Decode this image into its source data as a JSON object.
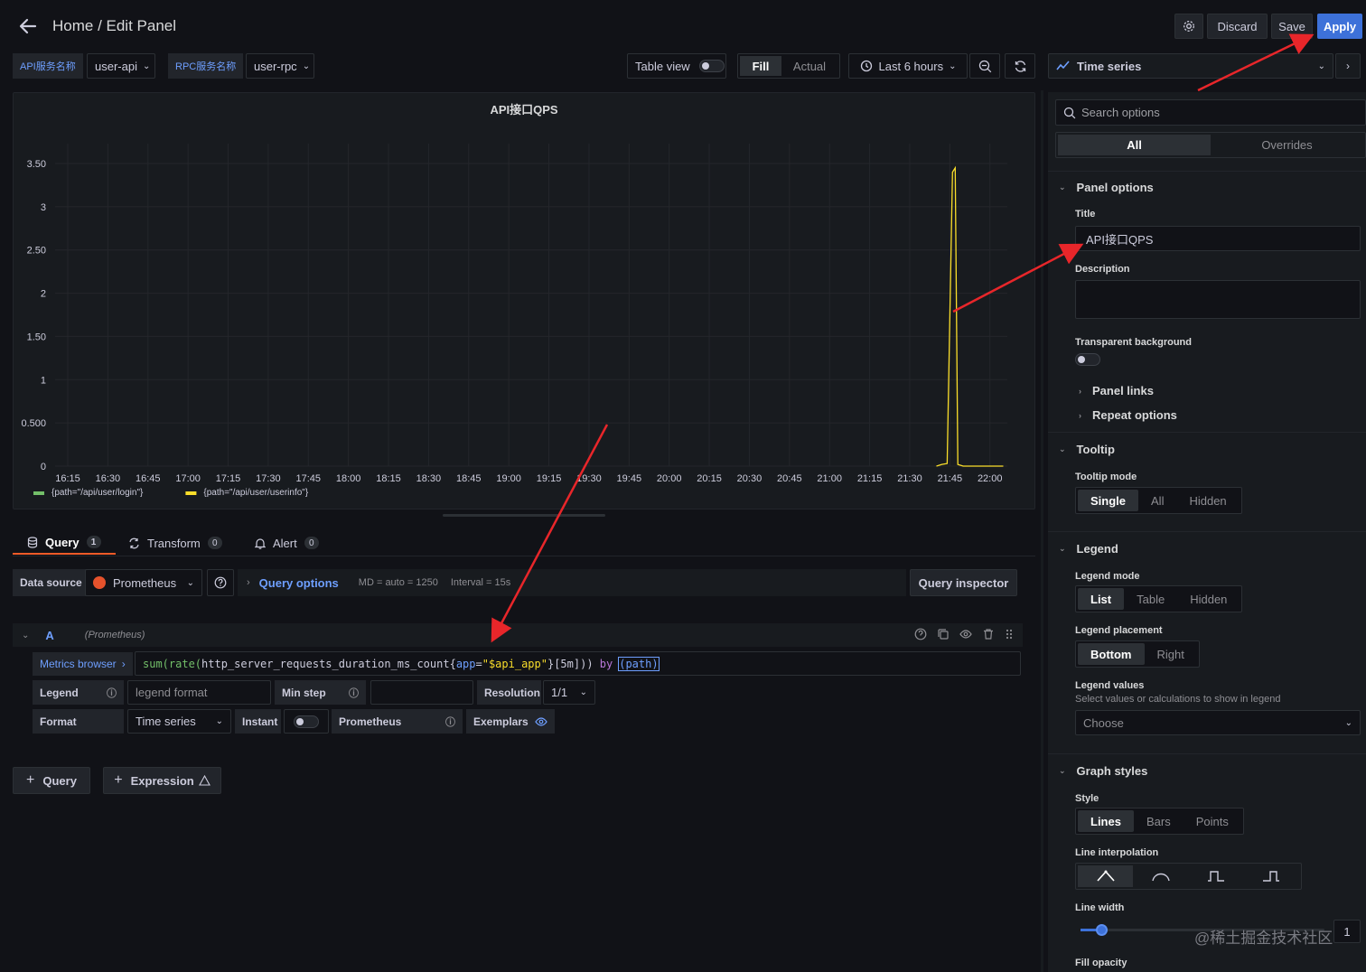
{
  "header": {
    "breadcrumb": "Home / Edit Panel",
    "discard_label": "Discard",
    "save_label": "Save",
    "apply_label": "Apply"
  },
  "variables": [
    {
      "label": "API服务名称",
      "value": "user-api"
    },
    {
      "label": "RPC服务名称",
      "value": "user-rpc"
    }
  ],
  "toolbar": {
    "table_view_label": "Table view",
    "fill_label": "Fill",
    "actual_label": "Actual",
    "time_range": "Last 6 hours",
    "visualization": "Time series"
  },
  "panel": {
    "title": "API接口QPS"
  },
  "chart_data": {
    "type": "line",
    "title": "API接口QPS",
    "x": [
      "16:15",
      "16:30",
      "16:45",
      "17:00",
      "17:15",
      "17:30",
      "17:45",
      "18:00",
      "18:15",
      "18:30",
      "18:45",
      "19:00",
      "19:15",
      "19:30",
      "19:45",
      "20:00",
      "20:15",
      "20:30",
      "20:45",
      "21:00",
      "21:15",
      "21:30",
      "21:45",
      "22:00"
    ],
    "yticks": [
      "0",
      "0.500",
      "1",
      "1.50",
      "2",
      "2.50",
      "3",
      "3.50"
    ],
    "ylim": [
      0,
      3.5
    ],
    "grid": true,
    "legend_placement": "bottom",
    "series": [
      {
        "name": "{path=\"/api/user/login\"}",
        "color": "#73bf69",
        "points": []
      },
      {
        "name": "{path=\"/api/user/userinfo\"}",
        "color": "#fade2a",
        "points": [
          [
            "21:40",
            0
          ],
          [
            "21:42",
            0.02
          ],
          [
            "21:44",
            0.03
          ],
          [
            "21:46",
            3.4
          ],
          [
            "21:47",
            3.45
          ],
          [
            "21:48",
            0.02
          ],
          [
            "21:50",
            0
          ],
          [
            "22:05",
            0
          ]
        ]
      }
    ]
  },
  "query_tabs": [
    {
      "label": "Query",
      "count": "1"
    },
    {
      "label": "Transform",
      "count": "0"
    },
    {
      "label": "Alert",
      "count": "0"
    }
  ],
  "query_row": {
    "data_source_label": "Data source",
    "data_source": "Prometheus",
    "query_options_label": "Query options",
    "md_info": "MD = auto = 1250",
    "interval_info": "Interval = 15s",
    "inspector_label": "Query inspector"
  },
  "query_a": {
    "ref": "A",
    "source": "(Prometheus)",
    "metrics_browser": "Metrics browser",
    "expr": {
      "fn": "sum(rate(",
      "metric": "http_server_requests_duration_ms_count",
      "lbrace": "{",
      "key": "app",
      "eq": "=",
      "val": "\"$api_app\"",
      "rest": "}[5m])) ",
      "by": "by",
      "arg": "(path)"
    },
    "legend_label": "Legend",
    "legend_placeholder": "legend format",
    "min_step_label": "Min step",
    "resolution_label": "Resolution",
    "resolution_value": "1/1",
    "format_label": "Format",
    "format_value": "Time series",
    "instant_label": "Instant",
    "prometheus_label": "Prometheus",
    "exemplars_label": "Exemplars"
  },
  "add_query_label": "Query",
  "add_expression_label": "Expression",
  "options": {
    "search_placeholder": "Search options",
    "tab_all": "All",
    "tab_overrides": "Overrides",
    "panel_options": "Panel options",
    "title_label": "Title",
    "title_value": "API接口QPS",
    "description_label": "Description",
    "transparent_label": "Transparent background",
    "panel_links": "Panel links",
    "repeat_options": "Repeat options",
    "tooltip": "Tooltip",
    "tooltip_mode_label": "Tooltip mode",
    "tooltip_modes": [
      "Single",
      "All",
      "Hidden"
    ],
    "legend": "Legend",
    "legend_mode_label": "Legend mode",
    "legend_modes": [
      "List",
      "Table",
      "Hidden"
    ],
    "legend_placement_label": "Legend placement",
    "legend_placements": [
      "Bottom",
      "Right"
    ],
    "legend_values_label": "Legend values",
    "legend_values_desc": "Select values or calculations to show in legend",
    "legend_values_placeholder": "Choose",
    "graph_styles": "Graph styles",
    "style_label": "Style",
    "styles": [
      "Lines",
      "Bars",
      "Points"
    ],
    "line_interp_label": "Line interpolation",
    "line_width_label": "Line width",
    "line_width_value": "1",
    "fill_opacity_label": "Fill opacity"
  },
  "watermark": "@稀土掘金技术社区"
}
